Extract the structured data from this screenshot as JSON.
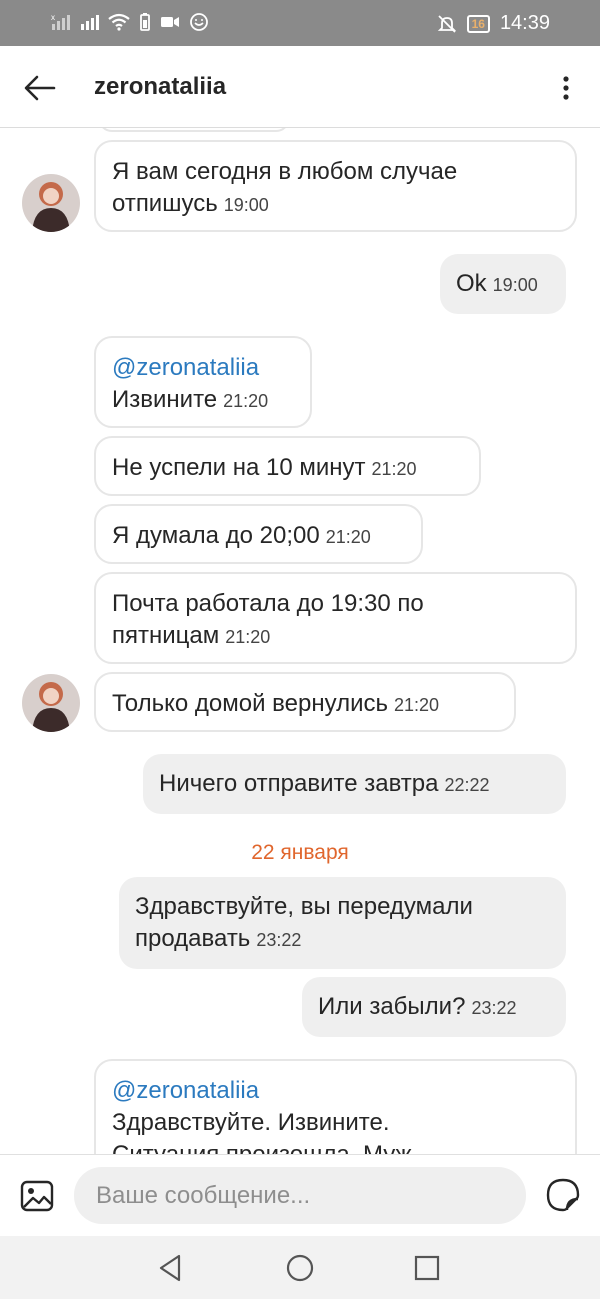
{
  "status_bar": {
    "time": "14:39",
    "battery": "16"
  },
  "header": {
    "title": "zeronataliia"
  },
  "messages": [
    {
      "id": "m1",
      "text": "Я вам сегодня в любом случае",
      "text2": "отпишусь",
      "time": "19:00"
    },
    {
      "id": "m2",
      "text": "Ok",
      "time": "19:00"
    },
    {
      "id": "m3",
      "mention": "@zeronataliia",
      "text": "Извините",
      "time": "21:20"
    },
    {
      "id": "m4",
      "text": "Не успели на 10 минут",
      "time": "21:20"
    },
    {
      "id": "m5",
      "text": "Я думала до 20;00",
      "time": "21:20"
    },
    {
      "id": "m6",
      "text": "Почта работала до 19:30 по",
      "text2": "пятницам",
      "time": "21:20"
    },
    {
      "id": "m7",
      "text": "Только домой вернулись",
      "time": "21:20"
    },
    {
      "id": "m8",
      "text": "Ничего отправите завтра",
      "time": "22:22"
    },
    {
      "id": "m9",
      "text": "Здравствуйте, вы передумали",
      "text2": "продавать",
      "time": "23:22"
    },
    {
      "id": "m10",
      "text": "Или забыли?",
      "time": "23:22"
    },
    {
      "id": "m11",
      "mention": "@zeronataliia",
      "text": "Здравствуйте. Извините.",
      "text2": "Ситуация произошла. Муж"
    }
  ],
  "date_separator": "22 января",
  "composer": {
    "placeholder": "Ваше сообщение..."
  },
  "colors": {
    "accent_date": "#e0662d",
    "mention": "#2b7abf",
    "outgoing_bubble": "#efefef"
  }
}
